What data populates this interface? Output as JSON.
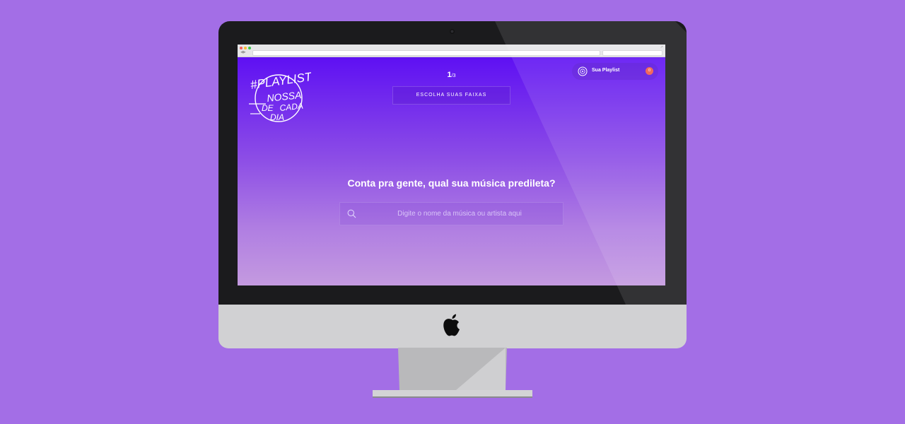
{
  "background_color": "#a36ee6",
  "app": {
    "step": {
      "current": "1",
      "separator": "/",
      "total": "3"
    },
    "step_title": "ESCOLHA SUAS FAIXAS",
    "playlist_button": {
      "label": "Sua Playlist",
      "count": "0",
      "icon": "disc-icon"
    },
    "question": "Conta pra gente, qual sua música predileta?",
    "search": {
      "placeholder": "Digite o nome da música ou artista aqui",
      "value": "",
      "icon": "search-icon"
    },
    "logo": {
      "lines": [
        "#PLAYLIST",
        "NOSSA",
        "DE",
        "CADA",
        "DIA"
      ]
    },
    "colors": {
      "gradient_top": "#5e10f3",
      "gradient_bottom": "#c49ae0",
      "badge": "#f0584a"
    }
  }
}
